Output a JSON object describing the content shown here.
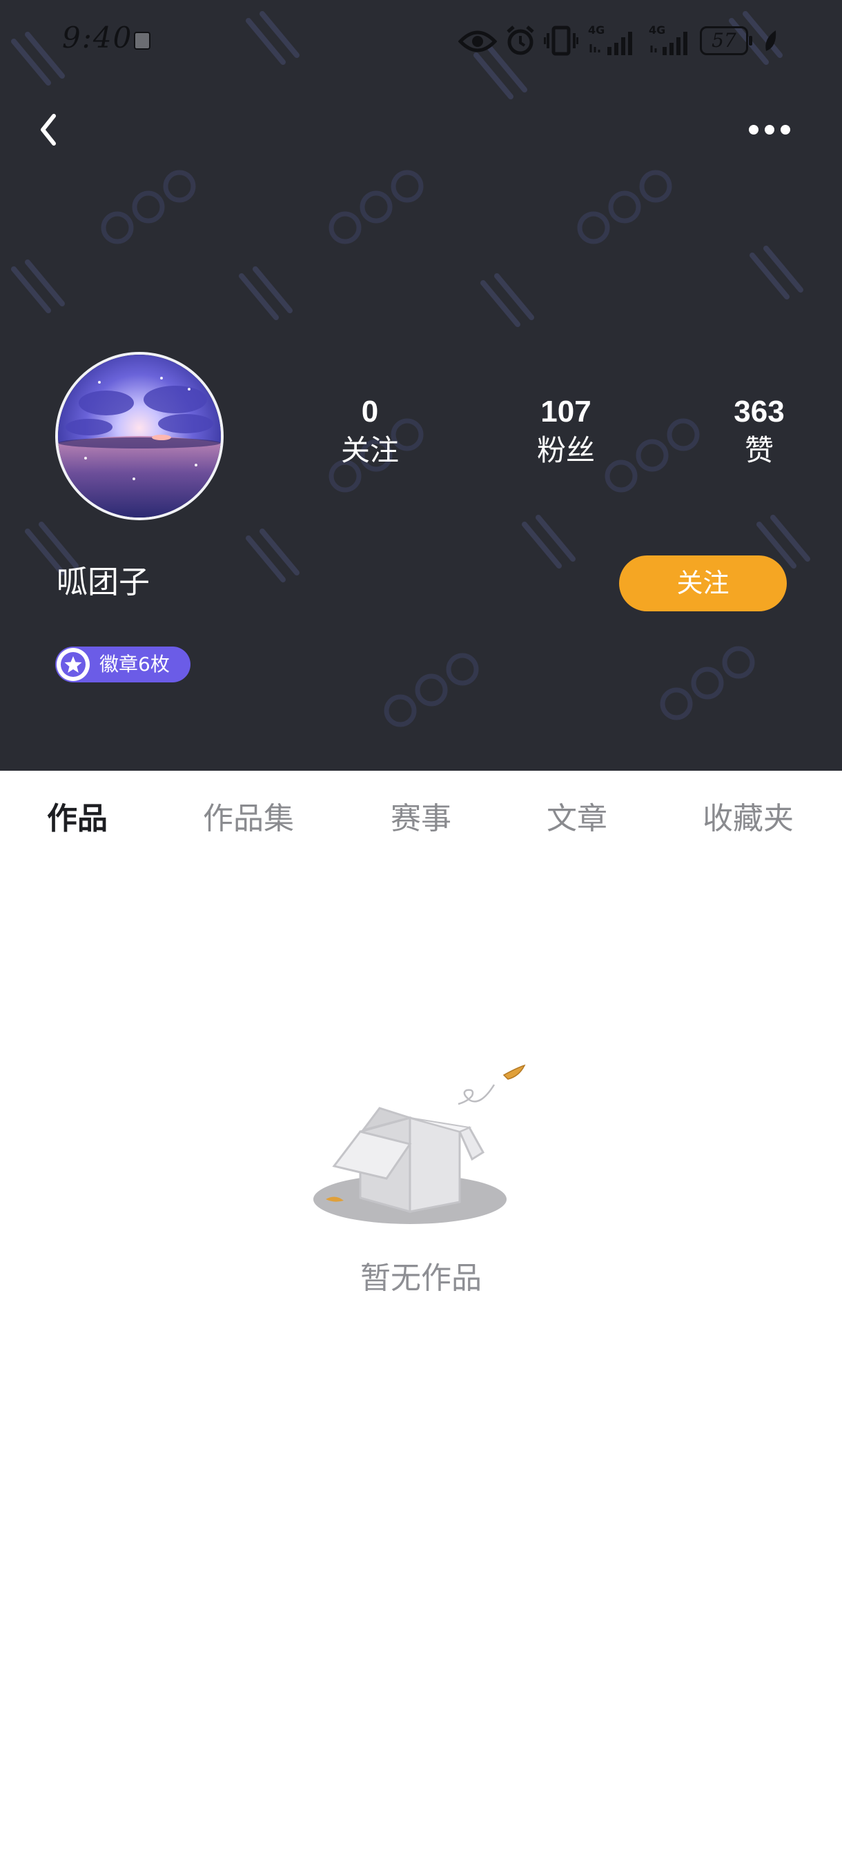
{
  "status_bar": {
    "time": "9:40",
    "battery": "57",
    "network_label_1": "4G",
    "network_label_2": "4G"
  },
  "navigation": {
    "back_icon": "chevron-left-icon",
    "more_icon": "more-dots-icon"
  },
  "profile": {
    "username": "呱团子",
    "stats": [
      {
        "value": "0",
        "label": "关注"
      },
      {
        "value": "107",
        "label": "粉丝"
      },
      {
        "value": "363",
        "label": "赞"
      }
    ],
    "follow_button": "关注",
    "badge": "徽章6枚"
  },
  "tabs": [
    {
      "label": "作品",
      "active": true
    },
    {
      "label": "作品集",
      "active": false
    },
    {
      "label": "赛事",
      "active": false
    },
    {
      "label": "文章",
      "active": false
    },
    {
      "label": "收藏夹",
      "active": false
    }
  ],
  "empty_state": {
    "message": "暂无作品"
  },
  "colors": {
    "header_bg": "#2a2c33",
    "accent": "#f5a623",
    "badge": "#6b5ce7"
  }
}
